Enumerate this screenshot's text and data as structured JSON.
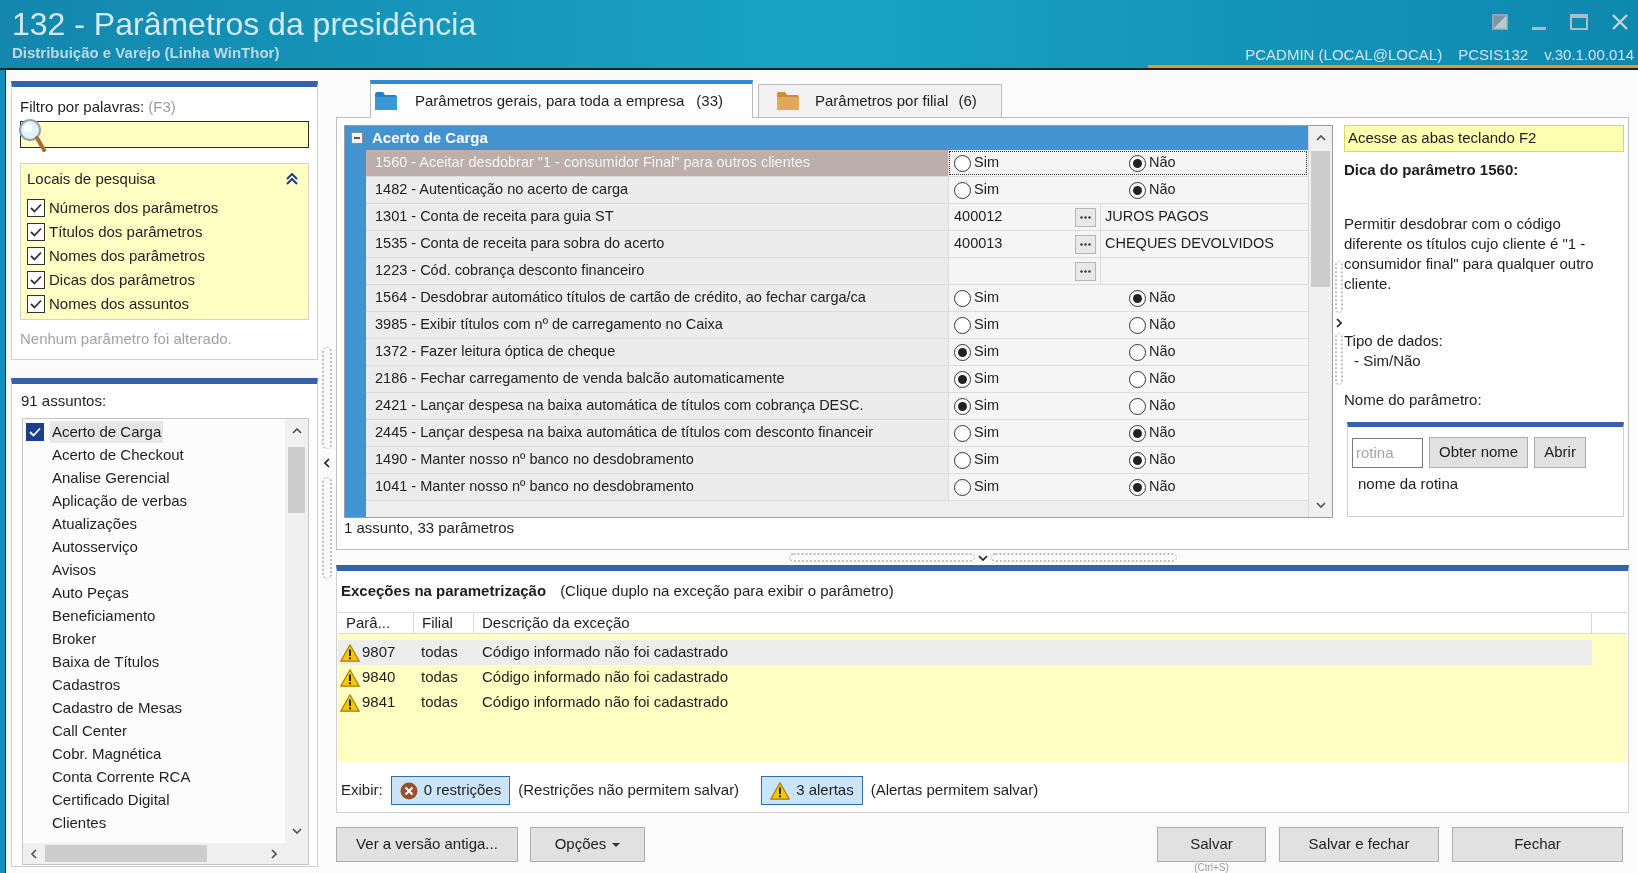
{
  "window": {
    "title": "132 - Parâmetros da presidência",
    "subtitle": "Distribuição e Varejo (Linha WinThor)",
    "user": "PCADMIN (LOCAL@LOCAL)",
    "program": "PCSIS132",
    "version": "v.30.1.00.014"
  },
  "filter": {
    "label": "Filtro por palavras:",
    "shortcut": "(F3)",
    "search_locations": {
      "title": "Locais de pesquisa",
      "expanded": true,
      "options": [
        {
          "label": "Números dos parâmetros",
          "checked": true
        },
        {
          "label": "Títulos dos parâmetros",
          "checked": true
        },
        {
          "label": "Nomes dos parâmetros",
          "checked": true
        },
        {
          "label": "Dicas dos parâmetros",
          "checked": true
        },
        {
          "label": "Nomes dos assuntos",
          "checked": true
        }
      ]
    },
    "status": "Nenhum parâmetro foi alterado."
  },
  "subjects": {
    "count_label": "91 assuntos:",
    "items": [
      {
        "label": "Acerto de Carga",
        "checked": true,
        "selected": true
      },
      {
        "label": "Acerto de Checkout",
        "checked": false,
        "selected": false
      },
      {
        "label": "Analise Gerencial",
        "checked": false,
        "selected": false
      },
      {
        "label": "Aplicação de verbas",
        "checked": false,
        "selected": false
      },
      {
        "label": "Atualizações",
        "checked": false,
        "selected": false
      },
      {
        "label": "Autosserviço",
        "checked": false,
        "selected": false
      },
      {
        "label": "Avisos",
        "checked": false,
        "selected": false
      },
      {
        "label": "Auto Peças",
        "checked": false,
        "selected": false
      },
      {
        "label": "Beneficiamento",
        "checked": false,
        "selected": false
      },
      {
        "label": "Broker",
        "checked": false,
        "selected": false
      },
      {
        "label": "Baixa de Títulos",
        "checked": false,
        "selected": false
      },
      {
        "label": "Cadastros",
        "checked": false,
        "selected": false
      },
      {
        "label": "Cadastro de Mesas",
        "checked": false,
        "selected": false
      },
      {
        "label": "Call Center",
        "checked": false,
        "selected": false
      },
      {
        "label": "Cobr. Magnética",
        "checked": false,
        "selected": false
      },
      {
        "label": "Conta Corrente RCA",
        "checked": false,
        "selected": false
      },
      {
        "label": "Certificado Digital",
        "checked": false,
        "selected": false
      },
      {
        "label": "Clientes",
        "checked": false,
        "selected": false
      }
    ]
  },
  "tabs": [
    {
      "label": "Parâmetros gerais, para toda a empresa",
      "count": "(33)",
      "selected": true
    },
    {
      "label": "Parâmetros por filial",
      "count": "(6)",
      "selected": false
    }
  ],
  "grid": {
    "group": {
      "title": "Acerto de Carga",
      "expanded": true
    },
    "rows": [
      {
        "label": "1560 - Aceitar desdobrar \"1 - consumidor Final\" para outros clientes",
        "kind": "yesno",
        "selected": true,
        "options": [
          {
            "label": "Sim",
            "selected": false
          },
          {
            "label": "Não",
            "selected": true
          }
        ]
      },
      {
        "label": "1482 - Autenticação no acerto de carga",
        "kind": "yesno",
        "selected": false,
        "options": [
          {
            "label": "Sim",
            "selected": false
          },
          {
            "label": "Não",
            "selected": true
          }
        ]
      },
      {
        "label": "1301 - Conta de receita para guia ST",
        "kind": "lookup",
        "selected": false,
        "code": "400012",
        "description": "JUROS PAGOS"
      },
      {
        "label": "1535 - Conta de receita para sobra do acerto",
        "kind": "lookup",
        "selected": false,
        "code": "400013",
        "description": "CHEQUES DEVOLVIDOS"
      },
      {
        "label": "1223 - Cód. cobrança desconto financeiro",
        "kind": "lookup",
        "selected": false
      },
      {
        "label": "1564 - Desdobrar automático títulos de cartão de crédito, ao fechar carga/ca",
        "kind": "yesno",
        "selected": false,
        "options": [
          {
            "label": "Sim",
            "selected": false
          },
          {
            "label": "Não",
            "selected": true
          }
        ]
      },
      {
        "label": "3985 - Exibir títulos com nº de carregamento no Caixa",
        "kind": "yesno",
        "selected": false,
        "options": [
          {
            "label": "Sim",
            "selected": false
          },
          {
            "label": "Não",
            "selected": false
          }
        ]
      },
      {
        "label": "1372 - Fazer leitura óptica de cheque",
        "kind": "yesno",
        "selected": false,
        "options": [
          {
            "label": "Sim",
            "selected": true
          },
          {
            "label": "Não",
            "selected": false
          }
        ]
      },
      {
        "label": "2186 - Fechar carregamento de venda balcão automaticamente",
        "kind": "yesno",
        "selected": false,
        "options": [
          {
            "label": "Sim",
            "selected": true
          },
          {
            "label": "Não",
            "selected": false
          }
        ]
      },
      {
        "label": "2421 - Lançar despesa na baixa automática de títulos com cobrança DESC.",
        "kind": "yesno",
        "selected": false,
        "options": [
          {
            "label": "Sim",
            "selected": true
          },
          {
            "label": "Não",
            "selected": false
          }
        ]
      },
      {
        "label": "2445 - Lançar despesa na baixa automática de títulos com desconto financeir",
        "kind": "yesno",
        "selected": false,
        "options": [
          {
            "label": "Sim",
            "selected": false
          },
          {
            "label": "Não",
            "selected": true
          }
        ]
      },
      {
        "label": "1490 - Manter nosso nº banco no desdobramento",
        "kind": "yesno",
        "selected": false,
        "options": [
          {
            "label": "Sim",
            "selected": false
          },
          {
            "label": "Não",
            "selected": true
          }
        ]
      },
      {
        "label": "1041 - Manter nosso nº banco no desdobramento",
        "kind": "yesno",
        "selected": false,
        "options": [
          {
            "label": "Sim",
            "selected": false
          },
          {
            "label": "Não",
            "selected": true
          }
        ]
      }
    ],
    "status": "1 assunto, 33 parâmetros"
  },
  "hint_panel": {
    "shortcut_hint": "Acesse as abas teclando F2",
    "title": "Dica do parâmetro 1560:",
    "description": "Permitir desdobrar com o código diferente os títulos cujo cliente é \"1 - consumidor final\" para qualquer outro cliente.",
    "data_type_label": "Tipo de dados:",
    "data_type": "- Sim/Não",
    "name_label": "Nome do parâmetro:",
    "routine": {
      "placeholder": "rotina",
      "buttons": [
        "Obter nome",
        "Abrir"
      ],
      "result": "nome da rotina"
    }
  },
  "exceptions": {
    "title": "Exceções na parametrização",
    "hint": "(Clique duplo na exceção para exibir o parâmetro)",
    "columns": [
      "Parâ...",
      "Filial",
      "Descrição da exceção"
    ],
    "rows": [
      {
        "kind": "alert",
        "param": "9807",
        "branch": "todas",
        "description": "Código informado não foi cadastrado",
        "selected": true
      },
      {
        "kind": "alert",
        "param": "9840",
        "branch": "todas",
        "description": "Código informado não foi cadastrado",
        "selected": false
      },
      {
        "kind": "alert",
        "param": "9841",
        "branch": "todas",
        "description": "Código informado não foi cadastrado",
        "selected": false
      }
    ],
    "show_label": "Exibir:",
    "filters": [
      {
        "kind": "restriction",
        "label": "0 restrições",
        "note": "(Restrições não permitem salvar)",
        "on": true
      },
      {
        "kind": "alert",
        "label": "3 alertas",
        "note": "(Alertas permitem salvar)",
        "on": true
      }
    ]
  },
  "buttons": {
    "left": [
      {
        "label": "Ver a versão antiga...",
        "kind": "plain"
      },
      {
        "label": "Opções",
        "kind": "menu"
      }
    ],
    "right": [
      {
        "label": "Salvar",
        "kind": "plain",
        "shortcut": "(Ctrl+S)"
      },
      {
        "label": "Salvar e fechar",
        "kind": "plain"
      },
      {
        "label": "Fechar",
        "kind": "plain"
      }
    ]
  }
}
